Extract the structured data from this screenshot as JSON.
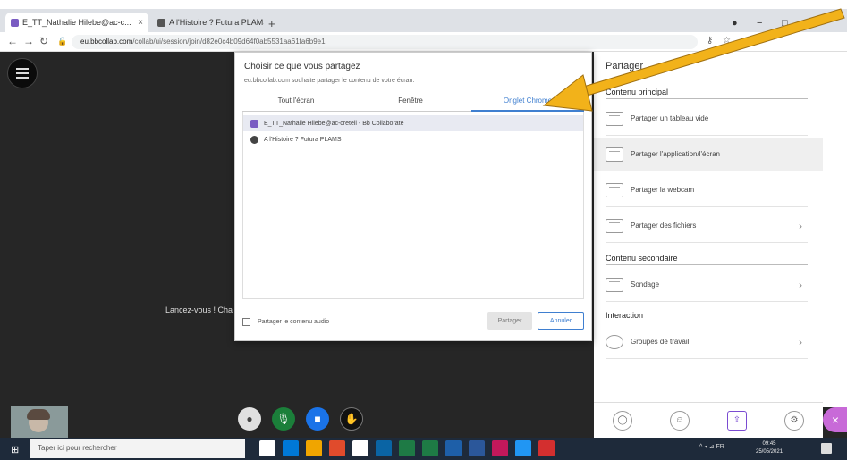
{
  "browser": {
    "tabs": [
      {
        "label": "E_TT_Nathalie Hilebe@ac-c...",
        "active": true,
        "color": "#7a5cc2"
      },
      {
        "label": "A l'Histoire ? Futura PLAMS",
        "active": false,
        "color": "#555555"
      }
    ],
    "new_tab": "+",
    "url_host": "eu.bbcollab.com",
    "url_path": "/collab/ui/session/join/d82e0c4b09d64f0ab5531aa61fa6b9e1",
    "window_controls": [
      "●",
      "−",
      "□",
      "×"
    ]
  },
  "app": {
    "stage_text": "Lancez-vous ! Cha",
    "controls": [
      {
        "name": "profile-icon",
        "glyph": "👤",
        "color": "#e0e0e0"
      },
      {
        "name": "microphone-icon",
        "glyph": "🎙",
        "color": "#1b7f3a"
      },
      {
        "name": "camera-icon",
        "glyph": "▬",
        "color": "#1a73e8"
      },
      {
        "name": "raise-hand-icon",
        "glyph": "✋",
        "color": "#111111"
      }
    ]
  },
  "panel": {
    "title": "Partager",
    "sections": {
      "main": "Contenu principal",
      "secondary": "Contenu secondaire",
      "interaction": "Interaction"
    },
    "items": [
      {
        "label": "Partager un tableau vide",
        "chevron": false
      },
      {
        "label": "Partager l'application/l'écran",
        "chevron": false,
        "selected": true
      },
      {
        "label": "Partager la webcam",
        "chevron": false
      },
      {
        "label": "Partager des fichiers",
        "chevron": true
      },
      {
        "label": "Sondage",
        "chevron": true
      },
      {
        "label": "Groupes de travail",
        "chevron": true
      }
    ],
    "footer_icons": [
      "chat-icon",
      "attendees-icon",
      "share-icon",
      "settings-icon"
    ],
    "close": "×"
  },
  "dialog": {
    "title": "Choisir ce que vous partagez",
    "subtitle": "eu.bbcollab.com souhaite partager le contenu de votre écran.",
    "tabs": [
      "Tout l'écran",
      "Fenêtre",
      "Onglet Chrome"
    ],
    "active_tab": 2,
    "rows": [
      {
        "label": "E_TT_Nathalie Hilebe@ac-creteil - Bb Collaborate",
        "color": "#7a5cc2",
        "selected": true
      },
      {
        "label": "A l'Histoire ? Futura PLAMS",
        "color": "#444444",
        "selected": false
      }
    ],
    "audio_label": "Partager le contenu audio",
    "share_label": "Partager",
    "cancel_label": "Annuler"
  },
  "taskbar": {
    "search_placeholder": "Taper ici pour rechercher",
    "tray_text": "^ ◂ ⊿ FR",
    "clock_time": "09:45",
    "clock_date": "25/05/2021",
    "apps": [
      "#ffffff",
      "#0078d7",
      "#f0a500",
      "#e04b2c",
      "#ffffff",
      "#0a64a4",
      "#1e7a45",
      "#1e7a45",
      "#1e5fa8",
      "#2b579a",
      "#c2185b",
      "#2196f3",
      "#d32f2f"
    ]
  },
  "colors": {
    "arrow": "#f2b21a",
    "accent": "#3f7fd0"
  }
}
